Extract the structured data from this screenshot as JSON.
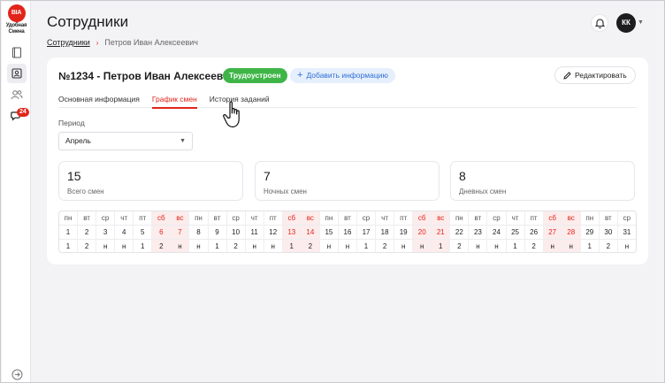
{
  "logo": {
    "mark": "BIA",
    "line1": "Удобная",
    "line2": "Смена"
  },
  "sidebar": {
    "icons": [
      "book-icon",
      "id-card-icon",
      "users-icon",
      "chat-icon"
    ],
    "chat_badge": "24",
    "bottom_icon": "arrow-right-circle-icon"
  },
  "header": {
    "title": "Сотрудники",
    "avatar_initials": "КК"
  },
  "breadcrumb": {
    "link": "Сотрудники",
    "separator": "›",
    "current": "Петров Иван Алексеевич"
  },
  "employee": {
    "title": "№1234 - Петров Иван Алексеевич",
    "status": "Трудоустроен",
    "add_info": "Добавить информацию",
    "edit": "Редактировать"
  },
  "tabs": [
    "Основная информация",
    "График смен",
    "История заданий"
  ],
  "active_tab": 1,
  "period": {
    "label": "Период",
    "value": "Апрель"
  },
  "stats": [
    {
      "value": "15",
      "label": "Всего смен"
    },
    {
      "value": "7",
      "label": "Ночных смен"
    },
    {
      "value": "8",
      "label": "Дневных смен"
    }
  ],
  "schedule": [
    {
      "dow": "пн",
      "date": "1",
      "shift": "1",
      "weekend": false
    },
    {
      "dow": "вт",
      "date": "2",
      "shift": "2",
      "weekend": false
    },
    {
      "dow": "ср",
      "date": "3",
      "shift": "н",
      "weekend": false
    },
    {
      "dow": "чт",
      "date": "4",
      "shift": "н",
      "weekend": false
    },
    {
      "dow": "пт",
      "date": "5",
      "shift": "1",
      "weekend": false
    },
    {
      "dow": "сб",
      "date": "6",
      "shift": "2",
      "weekend": true
    },
    {
      "dow": "вс",
      "date": "7",
      "shift": "н",
      "weekend": true
    },
    {
      "dow": "пн",
      "date": "8",
      "shift": "н",
      "weekend": false
    },
    {
      "dow": "вт",
      "date": "9",
      "shift": "1",
      "weekend": false
    },
    {
      "dow": "ср",
      "date": "10",
      "shift": "2",
      "weekend": false
    },
    {
      "dow": "чт",
      "date": "11",
      "shift": "н",
      "weekend": false
    },
    {
      "dow": "пт",
      "date": "12",
      "shift": "н",
      "weekend": false
    },
    {
      "dow": "сб",
      "date": "13",
      "shift": "1",
      "weekend": true
    },
    {
      "dow": "вс",
      "date": "14",
      "shift": "2",
      "weekend": true
    },
    {
      "dow": "пн",
      "date": "15",
      "shift": "н",
      "weekend": false
    },
    {
      "dow": "вт",
      "date": "16",
      "shift": "н",
      "weekend": false
    },
    {
      "dow": "ср",
      "date": "17",
      "shift": "1",
      "weekend": false
    },
    {
      "dow": "чт",
      "date": "18",
      "shift": "2",
      "weekend": false
    },
    {
      "dow": "пт",
      "date": "19",
      "shift": "н",
      "weekend": false
    },
    {
      "dow": "сб",
      "date": "20",
      "shift": "н",
      "weekend": true
    },
    {
      "dow": "вс",
      "date": "21",
      "shift": "1",
      "weekend": true
    },
    {
      "dow": "пн",
      "date": "22",
      "shift": "2",
      "weekend": false
    },
    {
      "dow": "вт",
      "date": "23",
      "shift": "н",
      "weekend": false
    },
    {
      "dow": "ср",
      "date": "24",
      "shift": "н",
      "weekend": false
    },
    {
      "dow": "чт",
      "date": "25",
      "shift": "1",
      "weekend": false
    },
    {
      "dow": "пт",
      "date": "26",
      "shift": "2",
      "weekend": false
    },
    {
      "dow": "сб",
      "date": "27",
      "shift": "н",
      "weekend": true
    },
    {
      "dow": "вс",
      "date": "28",
      "shift": "н",
      "weekend": true
    },
    {
      "dow": "пн",
      "date": "29",
      "shift": "1",
      "weekend": false
    },
    {
      "dow": "вт",
      "date": "30",
      "shift": "2",
      "weekend": false
    },
    {
      "dow": "ср",
      "date": "31",
      "shift": "н",
      "weekend": false
    }
  ],
  "colors": {
    "accent": "#e1251b",
    "success": "#3fb548",
    "link": "#2e6fd6",
    "weekend_bg": "#fcecec"
  }
}
